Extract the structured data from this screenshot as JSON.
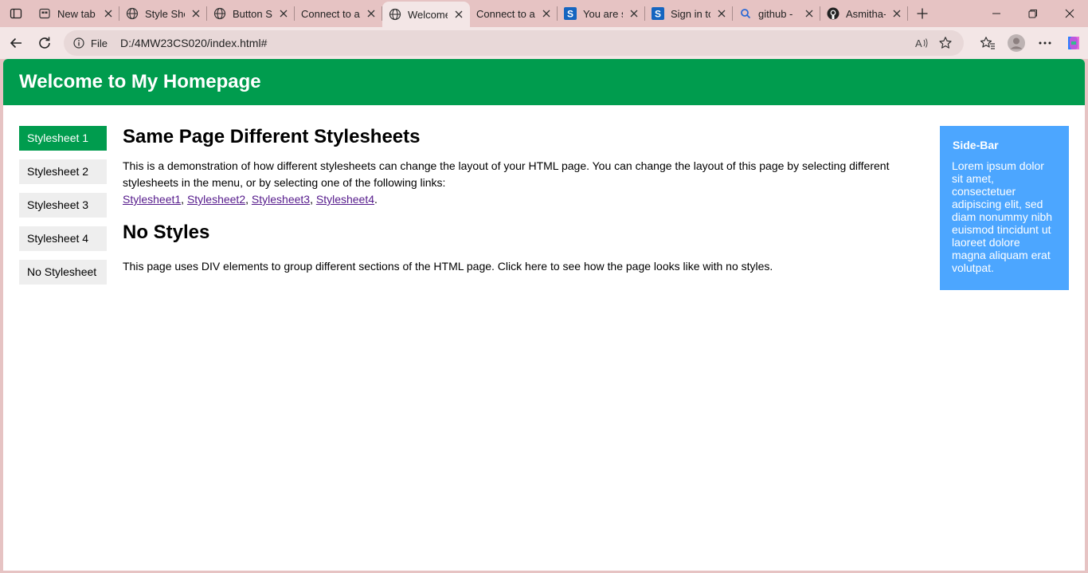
{
  "tabs": [
    {
      "title": "New tab",
      "icon": "new-tab-page-icon"
    },
    {
      "title": "Style She",
      "icon": "globe-icon"
    },
    {
      "title": "Button St",
      "icon": "globe-icon"
    },
    {
      "title": "Connect to a r",
      "icon": "none"
    },
    {
      "title": "Welcome",
      "icon": "globe-icon",
      "active": true
    },
    {
      "title": "Connect to a r",
      "icon": "none"
    },
    {
      "title": "You are s",
      "icon": "s-brand-icon"
    },
    {
      "title": "Sign in to",
      "icon": "s-brand-icon"
    },
    {
      "title": "github - ",
      "icon": "search-icon"
    },
    {
      "title": "Asmitha-",
      "icon": "github-icon"
    }
  ],
  "toolbar": {
    "scheme_label": "File",
    "url": "D:/4MW23CS020/index.html#"
  },
  "page": {
    "header_title": "Welcome to My Homepage",
    "menu": [
      "Stylesheet 1",
      "Stylesheet 2",
      "Stylesheet 3",
      "Stylesheet 4",
      "No Stylesheet"
    ],
    "heading1": "Same Page Different Stylesheets",
    "paragraph1": "This is a demonstration of how different stylesheets can change the layout of your HTML page. You can change the layout of this page by selecting different stylesheets in the menu, or by selecting one of the following links:",
    "links": [
      "Stylesheet1",
      "Stylesheet2",
      "Stylesheet3",
      "Stylesheet4"
    ],
    "link_sep": ", ",
    "link_end": ".",
    "heading2": "No Styles",
    "paragraph2": "This page uses DIV elements to group different sections of the HTML page. Click here to see how the page looks like with no styles.",
    "sidebar_title": "Side-Bar",
    "sidebar_text": "Lorem ipsum dolor sit amet, consectetuer adipiscing elit, sed diam nonummy nibh euismod tincidunt ut laoreet dolore magna aliquam erat volutpat."
  },
  "colors": {
    "header_green": "#009c4e",
    "sidebar_blue": "#4ca6ff",
    "link_purple": "#551a8b",
    "chrome_pink": "#e6c3c3"
  }
}
